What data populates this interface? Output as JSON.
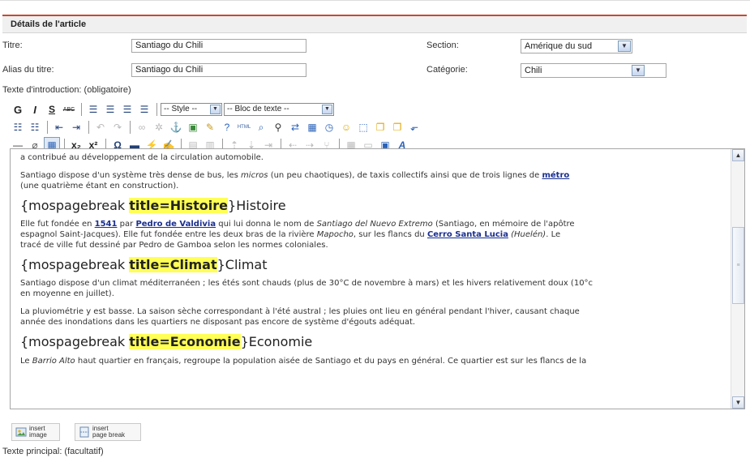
{
  "panel": {
    "title": "Détails de l'article"
  },
  "form": {
    "titre_label": "Titre:",
    "titre_value": "Santiago du Chili",
    "alias_label": "Alias du titre:",
    "alias_value": "Santiago du Chili",
    "section_label": "Section:",
    "section_value": "Amérique du sud",
    "categorie_label": "Catégorie:",
    "categorie_value": "Chili",
    "intro_label": "Texte d'introduction: (obligatoire)"
  },
  "toolbar": {
    "row1": {
      "bold": "G",
      "italic": "I",
      "underline": "S",
      "strike": "ABC",
      "style_select": "-- Style --",
      "block_select": "-- Bloc de texte --"
    },
    "html_label": "HTML"
  },
  "editor": {
    "p1": "a contribué au développement de la circulation automobile.",
    "p2_a": "Santiago dispose d'un système très dense de bus, les ",
    "p2_em": "micros",
    "p2_b": " (un peu chaotiques), de taxis collectifs ainsi que de trois lignes de ",
    "p2_link": "métro",
    "p2_c": "(une quatrième étant en construction).",
    "h1_a": "{mospagebreak ",
    "h1_hl": "title=Histoire",
    "h1_b": "}Histoire",
    "p3_a": "Elle fut fondée en ",
    "p3_link1": "1541",
    "p3_b": " par ",
    "p3_link2": "Pedro de Valdivia",
    "p3_c": " qui lui donna le nom de ",
    "p3_em1": "Santiago del Nuevo Extremo",
    "p3_d": " (Santiago, en mémoire de l'apôtre",
    "p3_e": "espagnol Saint-Jacques). Elle fut fondée entre les deux bras de la rivière ",
    "p3_em2": "Mapocho",
    "p3_f": ", sur les flancs du ",
    "p3_link3": "Cerro Santa Lucia",
    "p3_em3": " (Huelén)",
    "p3_g": ". Le",
    "p3_h": "tracé de ville fut dessiné par Pedro de Gamboa selon les normes coloniales.",
    "h2_a": "{mospagebreak ",
    "h2_hl": "title=Climat",
    "h2_b": "}Climat",
    "p4": "Santiago dispose d'un climat méditerranéen ; les étés sont chauds (plus de 30°C de novembre à mars) et les hivers relativement doux (10°c",
    "p4b": "en moyenne en juillet).",
    "p5": "La pluviométrie y est basse. La saison sèche correspondant à l'été austral ; les pluies ont lieu en général pendant l'hiver, causant chaque",
    "p5b": "année des inondations dans les quartiers ne disposant pas encore de système d'égouts adéquat.",
    "h3_a": "{mospagebreak ",
    "h3_hl": "title=Economie",
    "h3_b": "}Economie",
    "p6_a": "Le ",
    "p6_em": "Barrio Alto",
    "p6_b": " haut quartier en français, regroupe la population aisée de Santiago et du pays en général. Ce quartier est sur les flancs de la"
  },
  "buttons": {
    "insert_image_1": "insert",
    "insert_image_2": "image",
    "page_break_1": "insert",
    "page_break_2": "page break"
  },
  "footer": {
    "main_text_label": "Texte principal: (facultatif)"
  }
}
